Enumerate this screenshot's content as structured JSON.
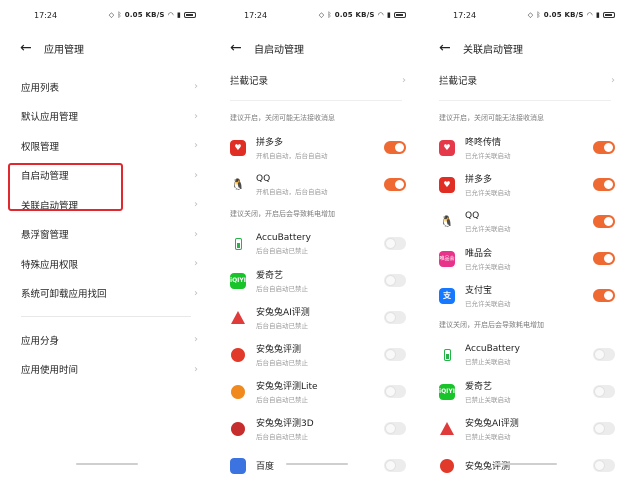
{
  "status_time": "17:24",
  "status_net": "0.05 KB/S",
  "panel1": {
    "title": "应用管理",
    "group1": [
      "应用列表",
      "默认应用管理",
      "权限管理",
      "自启动管理",
      "关联启动管理",
      "悬浮窗管理",
      "特殊应用权限",
      "系统可卸载应用找回"
    ],
    "group2": [
      "应用分身",
      "应用使用时间"
    ]
  },
  "panel2": {
    "title": "自启动管理",
    "intercept_label": "拦截记录",
    "section_on": "建议开启，关闭可能无法接收消息",
    "apps_on": [
      {
        "name": "拼多多",
        "sub": "开机自启动，后台自启动"
      },
      {
        "name": "QQ",
        "sub": "开机自启动，后台自启动"
      }
    ],
    "section_off": "建议关闭，开启后会导致耗电增加",
    "apps_off": [
      {
        "name": "AccuBattery",
        "sub": "后台自启动已禁止"
      },
      {
        "name": "爱奇艺",
        "sub": "后台自启动已禁止"
      },
      {
        "name": "安兔兔AI评测",
        "sub": "后台自启动已禁止"
      },
      {
        "name": "安兔兔评测",
        "sub": "后台自启动已禁止"
      },
      {
        "name": "安兔兔评测Lite",
        "sub": "后台自启动已禁止"
      },
      {
        "name": "安兔兔评测3D",
        "sub": "后台自启动已禁止"
      },
      {
        "name": "百度",
        "sub": ""
      }
    ]
  },
  "panel3": {
    "title": "关联启动管理",
    "intercept_label": "拦截记录",
    "section_on": "建议开启，关闭可能无法接收消息",
    "apps_on": [
      {
        "name": "咚咚传情",
        "sub": "已允许关联启动"
      },
      {
        "name": "拼多多",
        "sub": "已允许关联启动"
      },
      {
        "name": "QQ",
        "sub": "已允许关联启动"
      },
      {
        "name": "唯品会",
        "sub": "已允许关联启动"
      },
      {
        "name": "支付宝",
        "sub": "已允许关联启动"
      }
    ],
    "section_off": "建议关闭，开启后会导致耗电增加",
    "apps_off": [
      {
        "name": "AccuBattery",
        "sub": "已禁止关联启动"
      },
      {
        "name": "爱奇艺",
        "sub": "已禁止关联启动"
      },
      {
        "name": "安兔兔AI评测",
        "sub": "已禁止关联启动"
      },
      {
        "name": "安兔兔评测",
        "sub": ""
      }
    ]
  },
  "icon_labels": {
    "iqiyi": "iQIYI",
    "vip": "唯品会",
    "alipay": "支",
    "qq": "🐧"
  },
  "colors": {
    "toggle_on": "#ef6a33",
    "highlight": "#e0282e"
  }
}
